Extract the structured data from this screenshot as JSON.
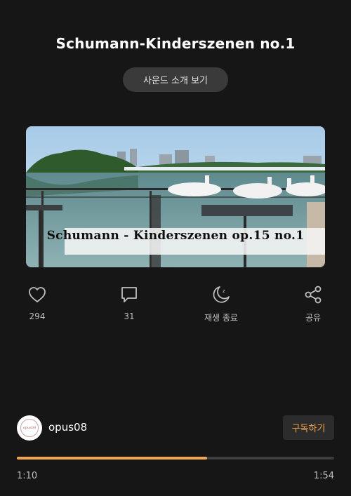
{
  "header": {
    "title": "Schumann-Kinderszenen no.1",
    "intro_button": "사운드 소개 보기"
  },
  "cover": {
    "caption": "Schumann - Kinderszenen op.15 no.1"
  },
  "actions": [
    {
      "icon": "heart-icon",
      "label": "294"
    },
    {
      "icon": "comment-icon",
      "label": "31"
    },
    {
      "icon": "sleep-timer-icon",
      "label": "재생 종료"
    },
    {
      "icon": "share-icon",
      "label": "공유"
    }
  ],
  "channel": {
    "name": "opus08",
    "subscribe_label": "구독하기",
    "avatar_text": "opus08"
  },
  "player": {
    "current_time": "1:10",
    "total_time": "1:54",
    "progress_fraction": 0.6
  },
  "colors": {
    "accent": "#f2a64c",
    "background": "#161616"
  }
}
